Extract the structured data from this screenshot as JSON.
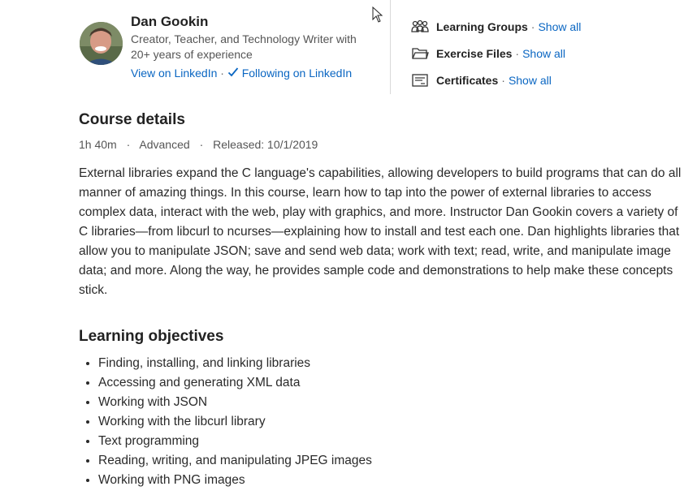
{
  "author": {
    "name": "Dan Gookin",
    "bio": "Creator, Teacher, and Technology Writer with 20+ years of experience",
    "view_linkedin": "View on LinkedIn",
    "separator": "·",
    "following": "Following on LinkedIn"
  },
  "side_links": [
    {
      "label": "Learning Groups",
      "action": "Show all",
      "icon": "people-group-icon"
    },
    {
      "label": "Exercise Files",
      "action": "Show all",
      "icon": "folder-icon"
    },
    {
      "label": "Certificates",
      "action": "Show all",
      "icon": "certificate-icon"
    }
  ],
  "course_details": {
    "title": "Course details",
    "duration": "1h 40m",
    "level": "Advanced",
    "released": "Released: 10/1/2019",
    "description": "External libraries expand the C language's capabilities, allowing developers to build programs that can do all manner of amazing things. In this course, learn how to tap into the power of external libraries to access complex data, interact with the web, play with graphics, and more. Instructor Dan Gookin covers a variety of C libraries—from libcurl to ncurses—explaining how to install and test each one. Dan highlights libraries that allow you to manipulate JSON; save and send web data; work with text; read, write, and manipulate image data; and more. Along the way, he provides sample code and demonstrations to help make these concepts stick."
  },
  "objectives": {
    "title": "Learning objectives",
    "items": [
      "Finding, installing, and linking libraries",
      "Accessing and generating XML data",
      "Working with JSON",
      "Working with the libcurl library",
      "Text programming",
      "Reading, writing, and manipulating JPEG images",
      "Working with PNG images"
    ]
  },
  "colors": {
    "link": "#0a66c2",
    "text": "#2a2a2a",
    "muted": "#555555"
  }
}
